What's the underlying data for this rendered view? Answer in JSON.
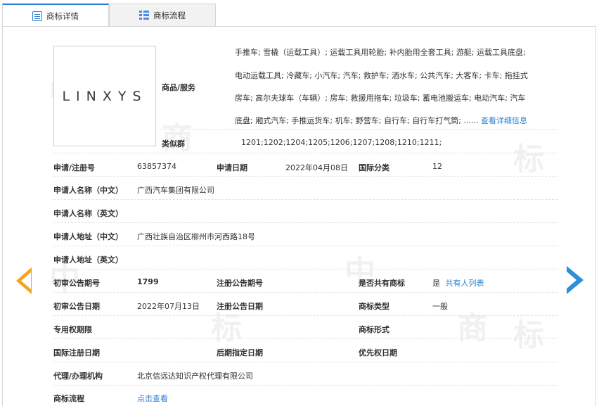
{
  "tabs": [
    {
      "label": "商标详情",
      "icon": "document-icon",
      "active": true
    },
    {
      "label": "商标流程",
      "icon": "list-icon",
      "active": false
    }
  ],
  "logo": {
    "text": "LINXYS"
  },
  "watermark": [
    "中",
    "国",
    "商",
    "标"
  ],
  "goods": {
    "label": "商品/服务",
    "lines": [
      "手推车; 雪橇（运载工具）; 运载工具用轮胎; 补内胎用全套工具; 游艇; 运载工具底盘;",
      "电动运载工具; 冷藏车; 小汽车; 汽车; 救护车; 洒水车; 公共汽车; 大客车; 卡车; 拖挂式",
      "房车; 高尔夫球车（车辆）; 房车; 救援用拖车; 垃圾车; 蓄电池搬运车; 电动汽车; 汽车",
      "底盘; 厢式汽车; 手推运货车; 机车; 野营车; 自行车; 自行车打气筒; ......"
    ],
    "more_link": "查看详细信息"
  },
  "similar_group": {
    "label": "类似群",
    "value": "1201;1202;1204;1205;1206;1207;1208;1210;1211;"
  },
  "fields": {
    "reg_no_label": "申请/注册号",
    "reg_no": "63857374",
    "apply_date_label": "申请日期",
    "apply_date": "2022年04月08日",
    "intl_class_label": "国际分类",
    "intl_class": "12",
    "applicant_cn_label": "申请人名称（中文）",
    "applicant_cn": "广西汽车集团有限公司",
    "applicant_en_label": "申请人名称（英文）",
    "applicant_en": "",
    "address_cn_label": "申请人地址（中文）",
    "address_cn": "广西壮族自治区柳州市河西路18号",
    "address_en_label": "申请人地址（英文）",
    "address_en": "",
    "prelim_issue_label": "初审公告期号",
    "prelim_issue": "1799",
    "reg_issue_label": "注册公告期号",
    "reg_issue": "",
    "shared_label": "是否共有商标",
    "shared": "是",
    "shared_link": "共有人列表",
    "prelim_date_label": "初审公告日期",
    "prelim_date": "2022年07月13日",
    "reg_date_label": "注册公告日期",
    "reg_date": "",
    "tm_type_label": "商标类型",
    "tm_type": "一般",
    "exclusive_label": "专用权期限",
    "exclusive": "",
    "tm_form_label": "商标形式",
    "tm_form": "",
    "intl_reg_date_label": "国际注册日期",
    "intl_reg_date": "",
    "later_date_label": "后期指定日期",
    "later_date": "",
    "priority_date_label": "优先权日期",
    "priority_date": "",
    "agent_label": "代理/办理机构",
    "agent": "北京信远达知识产权代理有限公司",
    "process_label": "商标流程",
    "process_link": "点击查看"
  },
  "colors": {
    "accent": "#2d7fd3",
    "prev_arrow": "#f5a21c",
    "next_arrow": "#2e8fd6"
  }
}
